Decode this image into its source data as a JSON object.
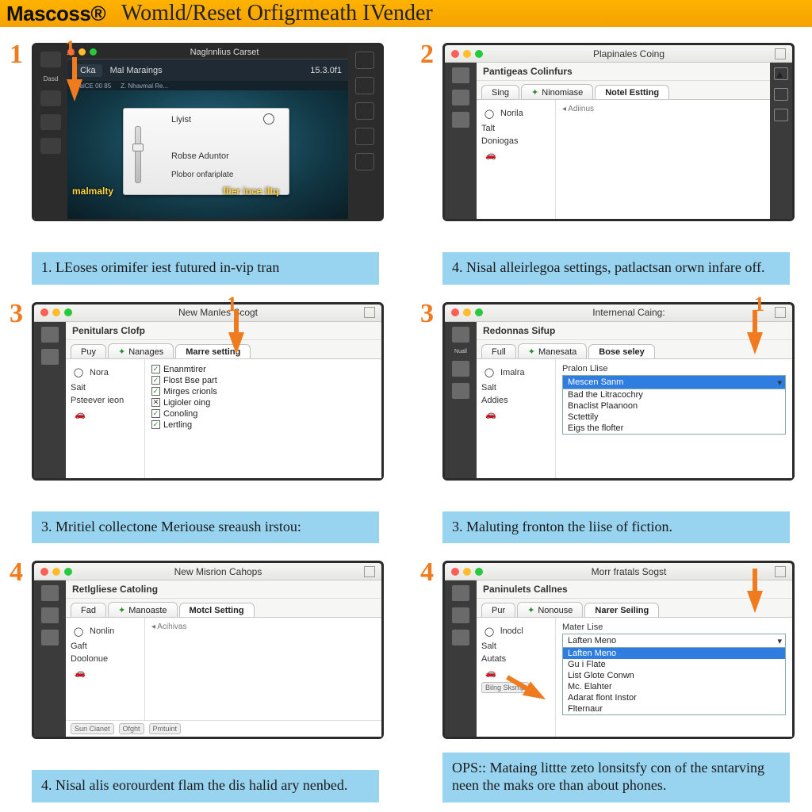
{
  "header": {
    "brand": "Mascoss®",
    "title": "Womld/Reset Orfigrmeath IVender"
  },
  "step1": {
    "num": "1",
    "window_title": "Naglnnlius Carset",
    "seg_left": "Cka",
    "seg_crumb": "ClalCE 00 85",
    "seg_main": "Mal Maraings",
    "seg_sub": "Z. Nhavmal Re...",
    "seg_time": "15.3.0f1",
    "card_light": "Liyist",
    "card_mid": "Robse Aduntor",
    "card_bottom": "Plobor onfariplate",
    "ylabel_left": "malmalty",
    "ylabel_right": "flier ince iltq",
    "side_label": "Dasd",
    "caption": "1. LEoses orimifer iest futured in-vip tran",
    "arrownum": "1"
  },
  "step2": {
    "num": "2",
    "window_title": "Plapinales Coing",
    "subhdr": "Pantigeas Colinfurs",
    "tab1": "Sing",
    "tab1p": "Ninomiase",
    "tab2": "Notel Estting",
    "nav1": "Norila",
    "nav2": "Talt",
    "nav3": "Doniogas",
    "crumb": "Adiinus",
    "caption": "4. Nisal alleirlegoa settings, patlactsan orwn infare off."
  },
  "step3": {
    "num": "3",
    "window_title": "New Manles Scogt",
    "subhdr": "Penitulars Clofp",
    "tab1": "Puy",
    "tab1p": "Nanages",
    "tab2": "Marre setting",
    "nav1": "Nora",
    "nav2": "Sait",
    "nav3": "Psteever ieon",
    "c1": "Enanmtirer",
    "c2": "Flost Bse part",
    "c3": "Mirges crionls",
    "c4": "Ligioler oing",
    "c5": "Conoling",
    "c6": "Lertling",
    "caption": "3. Mritiel collectone Meriouse sreaush irstou:",
    "arrownum": "1"
  },
  "step4": {
    "num": "3",
    "window_title": "Internenal Caing:",
    "subhdr": "Redonnas Sifup",
    "tab1": "Full",
    "tab1p": "Manesata",
    "tab2": "Bose seley",
    "nav1": "Imalra",
    "nav2": "Salt",
    "nav3": "Addies",
    "ddlabel": "Pralon Llise",
    "opts": [
      "Mescen Sanm",
      "Bad the Litracochry",
      "Bnaclist Plaanoon",
      "Sctettily",
      "Eigs the flofter"
    ],
    "caption": "3. Maluting fronton the liise of fiction.",
    "arrownum": "1"
  },
  "step5": {
    "num": "4",
    "window_title": "New Misrion Cahops",
    "subhdr": "Retlgliese Catoling",
    "tab1": "Fad",
    "tab1p": "Manoaste",
    "tab2": "Motcl Setting",
    "nav1": "Nonlin",
    "nav2": "Gaft",
    "nav3": "Doolonue",
    "crumb": "Acihivas",
    "foot1": "Sun Cianet",
    "foot2": "Ofght",
    "foot3": "Pmtuint",
    "caption": "4. Nisal alis eorourdent flam the dis halid ary nenbed."
  },
  "step6": {
    "num": "4",
    "window_title": "Morr fratals Sogst",
    "subhdr": "Paninulets Callnes",
    "tab1": "Pur",
    "tab1p": "Nonouse",
    "tab2": "Narer Seiling",
    "nav1": "lnodcl",
    "nav2": "Salt",
    "nav3": "Autats",
    "ddlabel": "Mater Lise",
    "opts": [
      "Laften Meno",
      "Gu i Flate",
      "List Glote Conwn",
      "Mc. Elahter",
      "Adarat flont Instor",
      "Flternaur"
    ],
    "foot": "Bilng Sksmp",
    "caption": "OPS:: Mataing littte zeto lonsitsfy con of the sntarving neen the maks ore than about phones."
  }
}
